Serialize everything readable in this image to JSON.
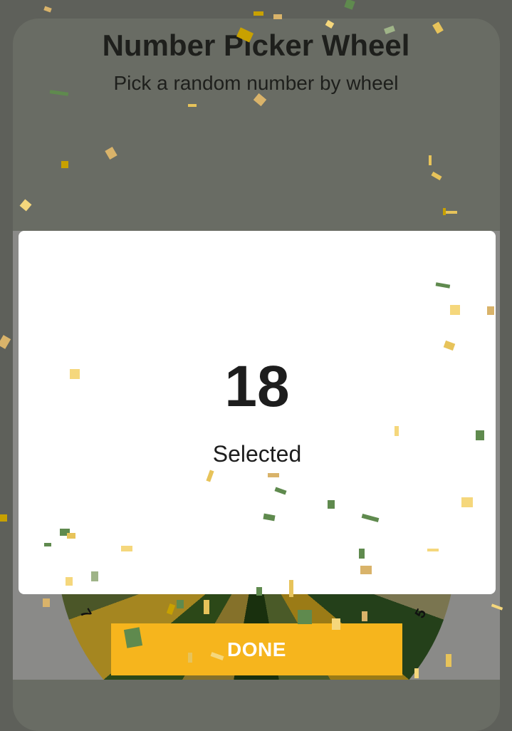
{
  "header": {
    "title": "Number Picker Wheel",
    "subtitle": "Pick a random number by wheel"
  },
  "wheel": {
    "visible_numbers": [
      "7",
      "5"
    ]
  },
  "dialog": {
    "selected_number": "18",
    "selected_label": "Selected",
    "done_label": "DONE"
  },
  "colors": {
    "overlay_bg": "#5e605a",
    "dialog_bg": "#ffffff",
    "done_button": "#f6b51d",
    "confetti": [
      "#f5d77c",
      "#d9b36a",
      "#5f8a4e",
      "#c8a100",
      "#e7c35a",
      "#9fb488",
      "#b89a2e"
    ]
  }
}
